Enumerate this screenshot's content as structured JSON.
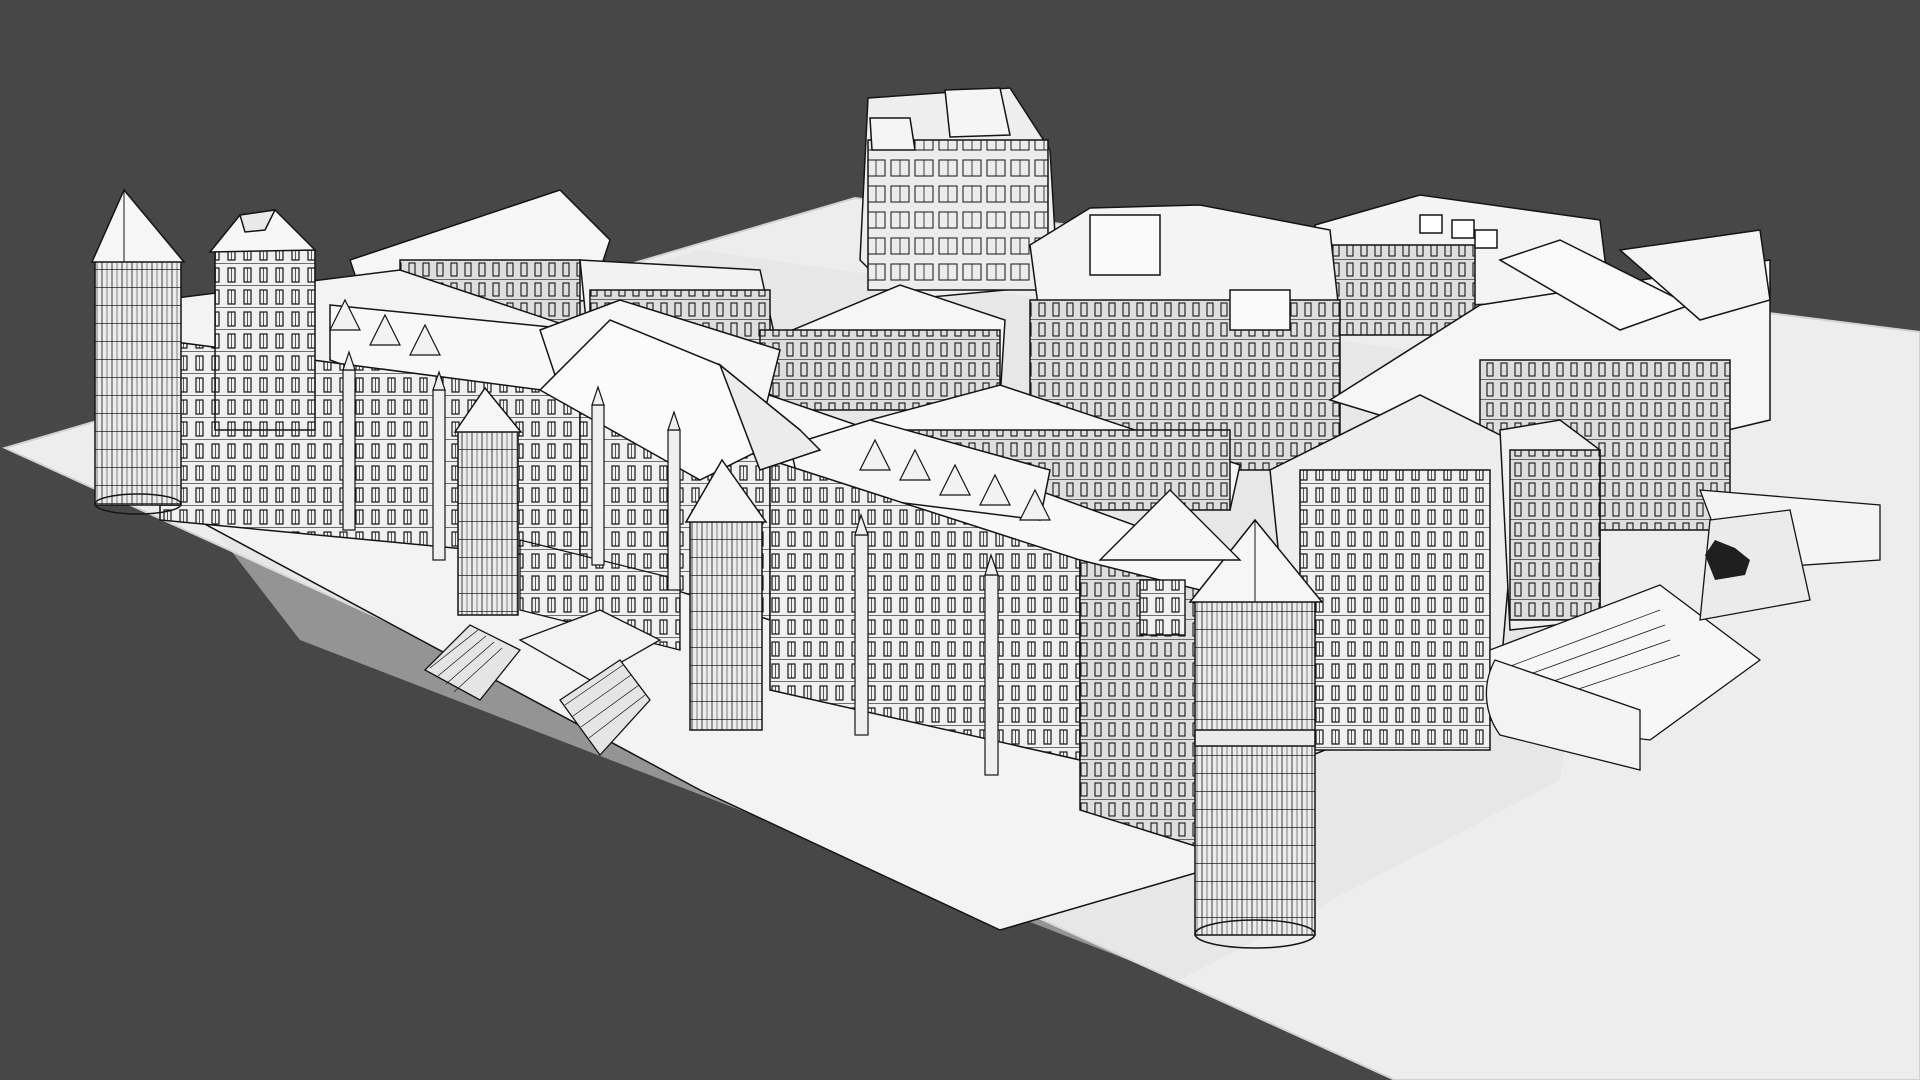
{
  "scene": {
    "background_color": "#474747",
    "base_plate_color": "#ededed",
    "building_fill": "#f2f2f2",
    "building_shade": "#dcdcdc",
    "roof_fill": "#f7f7f7",
    "line_color": "#151515"
  }
}
